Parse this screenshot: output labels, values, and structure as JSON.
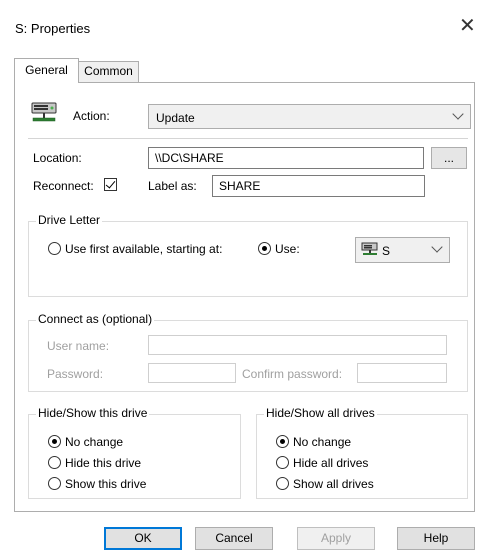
{
  "window": {
    "title": "S: Properties",
    "close_glyph": "✕"
  },
  "tabs": [
    {
      "label": "General",
      "active": true
    },
    {
      "label": "Common",
      "active": false
    }
  ],
  "action": {
    "icon": "network-drive-icon",
    "label": "Action:",
    "value": "Update"
  },
  "location": {
    "label": "Location:",
    "value": "\\\\DC\\SHARE",
    "browse_label": "..."
  },
  "reconnect": {
    "label": "Reconnect:",
    "checked": true
  },
  "label_as": {
    "label": "Label as:",
    "value": "SHARE"
  },
  "drive_letter": {
    "group_title": "Drive Letter",
    "option_first_available": "Use first available, starting at:",
    "option_use": "Use:",
    "selected": "use",
    "drive_value": "S",
    "drive_icon": "network-drive-icon"
  },
  "connect_as": {
    "group_title": "Connect as (optional)",
    "user_name_label": "User name:",
    "password_label": "Password:",
    "confirm_password_label": "Confirm password:",
    "user_name_value": "",
    "password_value": "",
    "confirm_password_value": ""
  },
  "hide_show_this": {
    "group_title": "Hide/Show this drive",
    "options": [
      "No change",
      "Hide this drive",
      "Show this drive"
    ],
    "selected_index": 0
  },
  "hide_show_all": {
    "group_title": "Hide/Show all drives",
    "options": [
      "No change",
      "Hide all drives",
      "Show all drives"
    ],
    "selected_index": 0
  },
  "buttons": {
    "ok": "OK",
    "cancel": "Cancel",
    "apply": "Apply",
    "help": "Help"
  },
  "colors": {
    "default_button_border": "#0078d7",
    "disabled_text": "#a0a0a0"
  }
}
